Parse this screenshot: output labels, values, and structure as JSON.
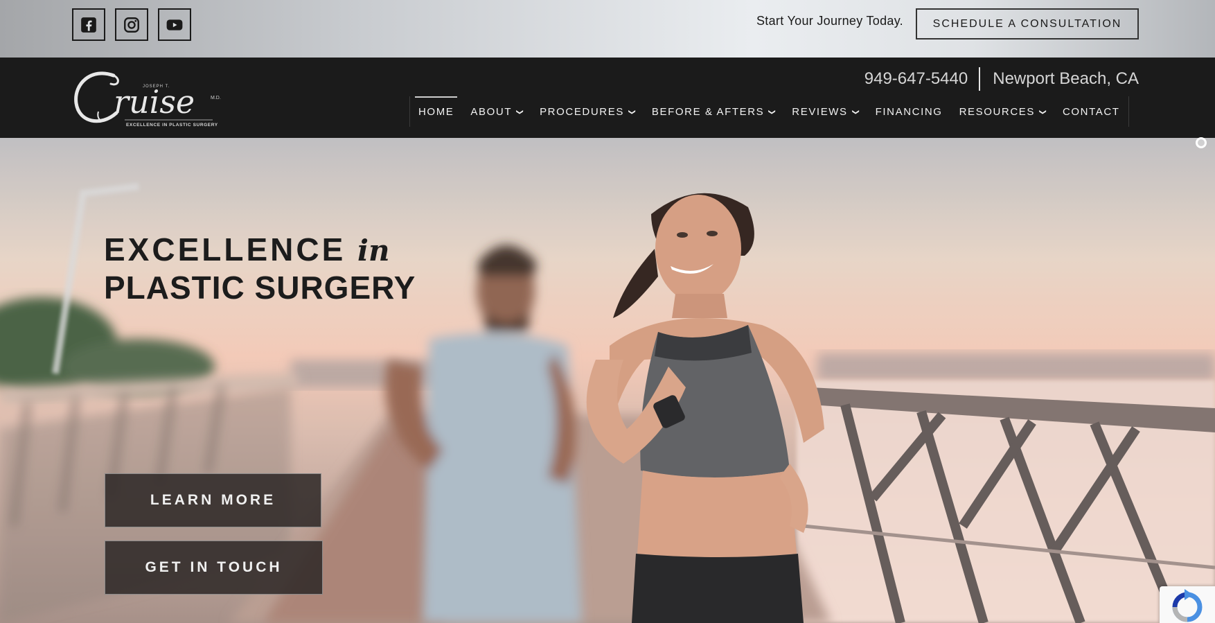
{
  "topbar": {
    "social": [
      {
        "name": "facebook-icon"
      },
      {
        "name": "instagram-icon"
      },
      {
        "name": "youtube-icon"
      }
    ],
    "tagline": "Start Your Journey Today.",
    "consult_label": "SCHEDULE A CONSULTATION"
  },
  "header": {
    "logo": {
      "brand": "Cruise",
      "small_name": "JOSEPH T.",
      "suffix": "M.D.",
      "tagline": "EXCELLENCE IN PLASTIC SURGERY"
    },
    "phone": "949-647-5440",
    "location": "Newport Beach, CA",
    "nav": [
      {
        "label": "HOME",
        "dropdown": false,
        "active": true
      },
      {
        "label": "ABOUT",
        "dropdown": true
      },
      {
        "label": "PROCEDURES",
        "dropdown": true
      },
      {
        "label": "BEFORE & AFTERS",
        "dropdown": true
      },
      {
        "label": "REVIEWS",
        "dropdown": true
      },
      {
        "label": "FINANCING",
        "dropdown": false
      },
      {
        "label": "RESOURCES",
        "dropdown": true
      },
      {
        "label": "CONTACT",
        "dropdown": false
      }
    ]
  },
  "hero": {
    "title_line1": "EXCELLENCE",
    "title_in": "in",
    "title_line2": "PLASTIC SURGERY",
    "learn_more": "LEARN MORE",
    "get_in_touch": "GET IN TOUCH"
  },
  "colors": {
    "header_bg": "#1b1b1b",
    "text_light": "#f2f2f2",
    "cta_bg": "#2d2826"
  }
}
